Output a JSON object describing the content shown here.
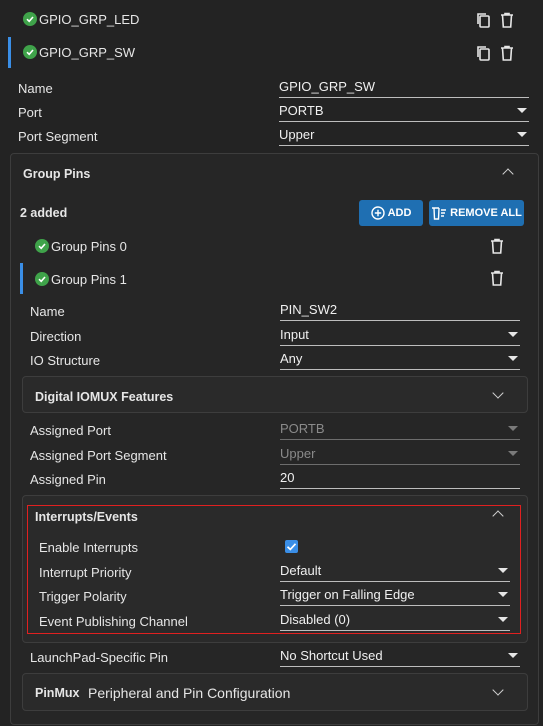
{
  "top_items": [
    {
      "label": "GPIO_GRP_LED"
    },
    {
      "label": "GPIO_GRP_SW"
    }
  ],
  "group": {
    "name_label": "Name",
    "name_value": "GPIO_GRP_SW",
    "port_label": "Port",
    "port_value": "PORTB",
    "segment_label": "Port Segment",
    "segment_value": "Upper"
  },
  "group_pins": {
    "title": "Group Pins",
    "count_text": "2 added",
    "add_label": "ADD",
    "remove_all_label": "REMOVE ALL",
    "items": [
      {
        "label": "Group Pins 0"
      },
      {
        "label": "Group Pins 1"
      }
    ],
    "name_label": "Name",
    "name_value": "PIN_SW2",
    "direction_label": "Direction",
    "direction_value": "Input",
    "io_label": "IO Structure",
    "io_value": "Any"
  },
  "digital_iomux": {
    "title": "Digital IOMUX Features",
    "assigned_port_label": "Assigned Port",
    "assigned_port_value": "PORTB",
    "assigned_segment_label": "Assigned Port Segment",
    "assigned_segment_value": "Upper",
    "assigned_pin_label": "Assigned Pin",
    "assigned_pin_value": "20"
  },
  "interrupts": {
    "title": "Interrupts/Events",
    "enable_label": "Enable Interrupts",
    "enable_checked": true,
    "priority_label": "Interrupt Priority",
    "priority_value": "Default",
    "polarity_label": "Trigger Polarity",
    "polarity_value": "Trigger on Falling Edge",
    "channel_label": "Event Publishing Channel",
    "channel_value": "Disabled (0)"
  },
  "launchpad": {
    "label": "LaunchPad-Specific Pin",
    "value": "No Shortcut Used"
  },
  "pinmux": {
    "title": "PinMux",
    "subtitle": "Peripheral and Pin Configuration"
  },
  "colors": {
    "accent": "#1f6fb2",
    "highlight_border": "#e02020",
    "check": "#3fa34a"
  }
}
